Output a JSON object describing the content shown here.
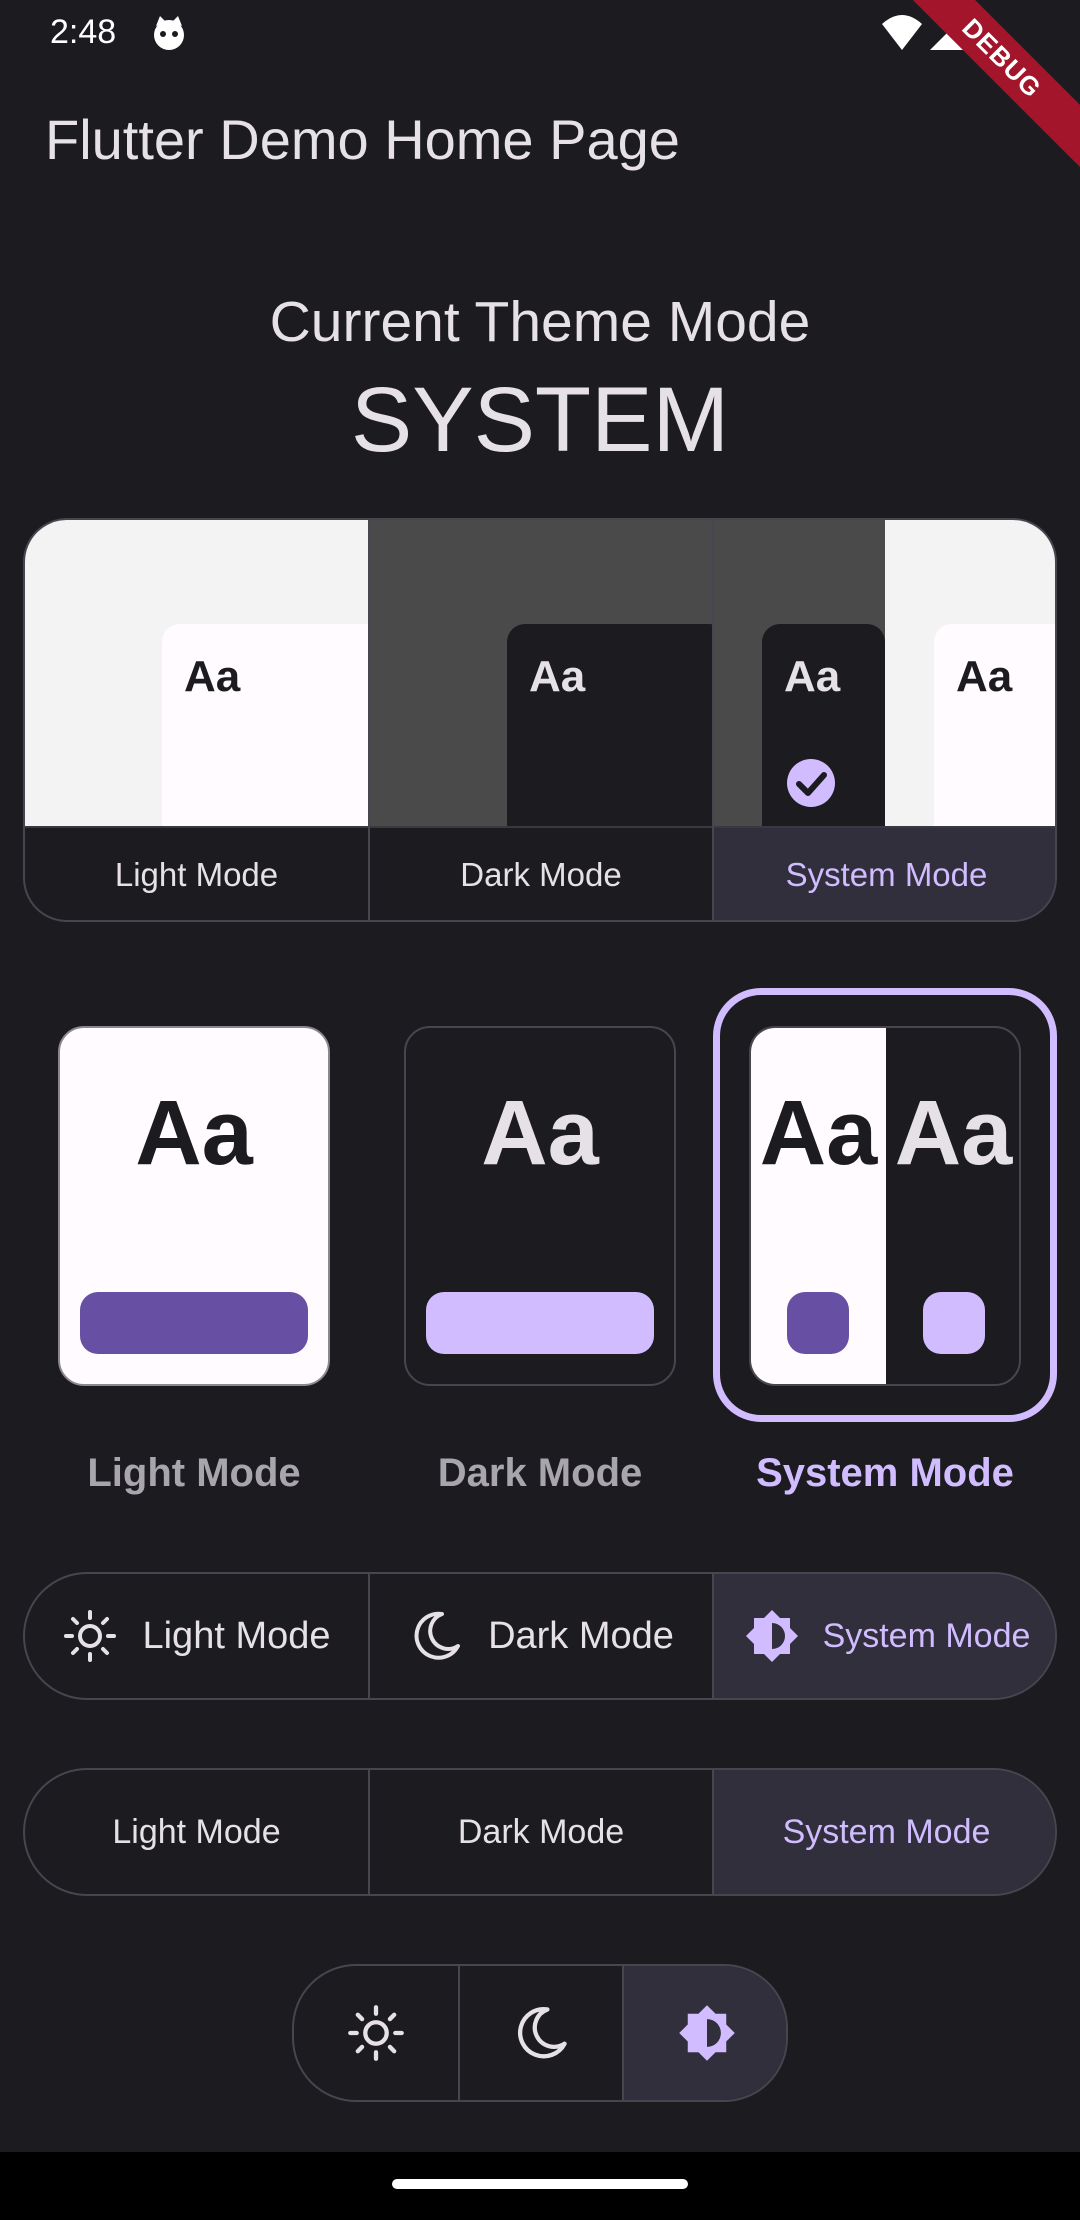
{
  "status_bar": {
    "time": "2:48"
  },
  "debug_banner": "DEBUG",
  "app_bar": {
    "title": "Flutter Demo Home Page"
  },
  "theme_header": {
    "label": "Current Theme Mode",
    "value": "SYSTEM"
  },
  "preview_options": {
    "items": [
      {
        "label": "Light Mode",
        "sample": "Aa"
      },
      {
        "label": "Dark Mode",
        "sample": "Aa"
      },
      {
        "label": "System Mode",
        "sample_dark": "Aa",
        "sample_light": "Aa"
      }
    ],
    "selected": "System Mode"
  },
  "card_options": {
    "items": [
      {
        "label": "Light Mode",
        "sample": "Aa"
      },
      {
        "label": "Dark Mode",
        "sample": "Aa"
      },
      {
        "label": "System Mode",
        "sample_light": "Aa",
        "sample_dark": "Aa"
      }
    ],
    "selected": "System Mode"
  },
  "icon_label_segments": {
    "items": [
      {
        "label": "Light Mode",
        "icon": "sun-icon"
      },
      {
        "label": "Dark Mode",
        "icon": "moon-icon"
      },
      {
        "label": "System Mode",
        "icon": "brightness-auto-icon"
      }
    ],
    "selected": "System Mode"
  },
  "text_segments": {
    "items": [
      {
        "label": "Light Mode"
      },
      {
        "label": "Dark Mode"
      },
      {
        "label": "System Mode"
      }
    ],
    "selected": "System Mode"
  },
  "icon_segments": {
    "items": [
      {
        "icon": "sun-icon"
      },
      {
        "icon": "moon-icon"
      },
      {
        "icon": "brightness-auto-icon"
      }
    ],
    "selected": "brightness-auto-icon"
  },
  "colors": {
    "background": "#1c1b20",
    "accent": "#d0bcff",
    "accent_dark": "#6750a4",
    "selected_segment": "#322f3d",
    "debug": "#a3152b"
  }
}
